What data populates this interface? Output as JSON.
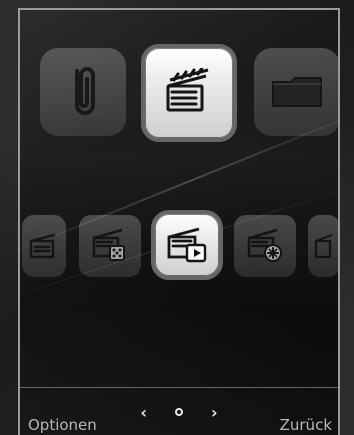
{
  "softkeys": {
    "left": "Optionen",
    "right": "Zurück"
  },
  "nav": {
    "prev": "‹",
    "next": "›"
  },
  "tiles": {
    "top_left": "paperclip-icon",
    "top_center": "clapperboard-icon",
    "top_right": "folder-icon",
    "bottom_0": "clapperboard-icon",
    "bottom_1": "clapperboard-dice-icon",
    "bottom_2": "clapperboard-play-icon",
    "bottom_3": "clapperboard-settings-icon",
    "bottom_4": "clapperboard-icon"
  }
}
